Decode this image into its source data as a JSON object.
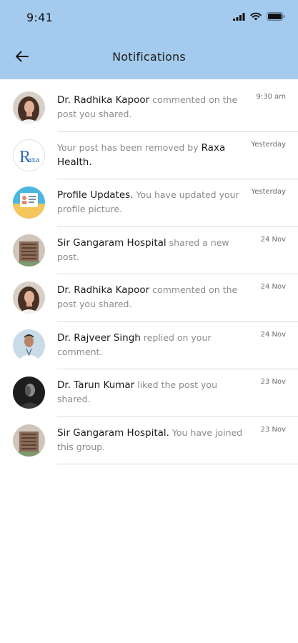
{
  "status_bar": {
    "time": "9:41"
  },
  "header": {
    "title": "Notifications",
    "back_icon": "arrow-left-icon"
  },
  "colors": {
    "header_bg": "#a4cbee",
    "divider": "#d9d9d9",
    "muted_text": "#8b8b8b"
  },
  "notifications": [
    {
      "avatar": "woman-portrait-avatar",
      "name": "Dr. Radhika Kapoor",
      "before": "",
      "after": " commented on the post you shared.",
      "time": "9:30 am"
    },
    {
      "avatar": "raxa-logo-avatar",
      "name": "Raxa Health.",
      "before": "Your post has been removed by ",
      "after": "",
      "time": "Yesterday"
    },
    {
      "avatar": "profile-card-avatar",
      "name": "Profile Updates.",
      "before": "",
      "after": " You have updated your profile picture.",
      "time": "Yesterday"
    },
    {
      "avatar": "hospital-building-avatar",
      "name": "Sir Gangaram Hospital",
      "before": "",
      "after": "  shared a new post.",
      "time": "24 Nov"
    },
    {
      "avatar": "woman-portrait-avatar",
      "name": "Dr. Radhika Kapoor",
      "before": "",
      "after": " commented on the post you shared.",
      "time": "24 Nov"
    },
    {
      "avatar": "doctor-portrait-avatar",
      "name": "Dr. Rajveer Singh",
      "before": "",
      "after": " replied on your comment.",
      "time": "24 Nov"
    },
    {
      "avatar": "man-dark-portrait-avatar",
      "name": "Dr. Tarun Kumar",
      "before": "",
      "after": " liked the post you shared.",
      "time": "23 Nov"
    },
    {
      "avatar": "hospital-building-avatar",
      "name": "Sir Gangaram Hospital.",
      "before": "",
      "after": " You have joined this group.",
      "time": "23 Nov"
    }
  ]
}
